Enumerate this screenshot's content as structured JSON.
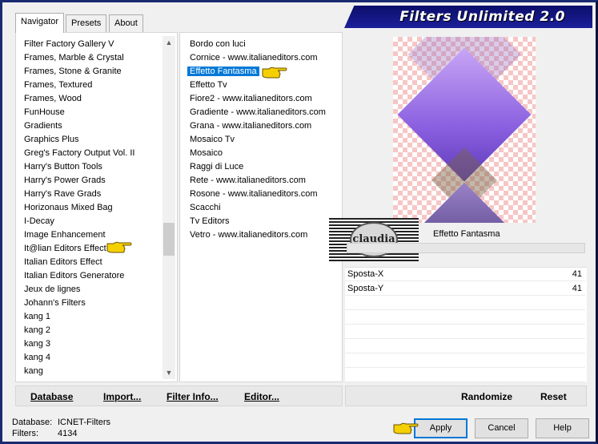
{
  "window": {
    "title": "Filters Unlimited 2.0"
  },
  "tabs": [
    {
      "label": "Navigator",
      "active": true
    },
    {
      "label": "Presets",
      "active": false
    },
    {
      "label": "About",
      "active": false
    }
  ],
  "categories": [
    "Filter Factory Gallery V",
    "Frames, Marble & Crystal",
    "Frames, Stone & Granite",
    "Frames, Textured",
    "Frames, Wood",
    "FunHouse",
    "Gradients",
    "Graphics Plus",
    "Greg's Factory Output Vol. II",
    "Harry's Button Tools",
    "Harry's Power Grads",
    "Harry's Rave Grads",
    "Horizonaus Mixed Bag",
    "I-Decay",
    "Image Enhancement",
    "It@lian Editors Effect",
    "Italian Editors Effect",
    "Italian Editors Generatore",
    "Jeux de lignes",
    "Johann's Filters",
    "kang 1",
    "kang 2",
    "kang 3",
    "kang 4",
    "kang"
  ],
  "filters": [
    "Bordo con luci",
    "Cornice - www.italianeditors.com",
    "Effetto Fantasma",
    "Effetto Tv",
    "Fiore2 - www.italianeditors.com",
    "Gradiente - www.italianeditors.com",
    "Grana - www.italianeditors.com",
    "Mosaico Tv",
    "Mosaico",
    "Raggi di Luce",
    "Rete - www.italianeditors.com",
    "Rosone - www.italianeditors.com",
    "Scacchi",
    "Tv Editors",
    "Vetro - www.italianeditors.com"
  ],
  "selected_filter_index": 2,
  "preview": {
    "effect_name": "Effetto Fantasma",
    "logo_text": "claudia"
  },
  "sliders": [
    {
      "label": "Sposta-X",
      "value": "41"
    },
    {
      "label": "Sposta-Y",
      "value": "41"
    }
  ],
  "toolbar": {
    "database": "Database",
    "import": "Import...",
    "filter_info": "Filter Info...",
    "editor": "Editor...",
    "randomize": "Randomize",
    "reset": "Reset"
  },
  "status": {
    "database_label": "Database:",
    "database_value": "ICNET-Filters",
    "filters_label": "Filters:",
    "filters_value": "4134"
  },
  "buttons": {
    "apply": "Apply",
    "cancel": "Cancel",
    "help": "Help"
  },
  "colors": {
    "selection": "#0078d7",
    "banner": "#1b1f9a",
    "hand": "#f5d000"
  },
  "icons": {
    "scroll_up": "chevron-up-icon",
    "scroll_down": "chevron-down-icon",
    "pointer": "pointing-hand-icon"
  }
}
